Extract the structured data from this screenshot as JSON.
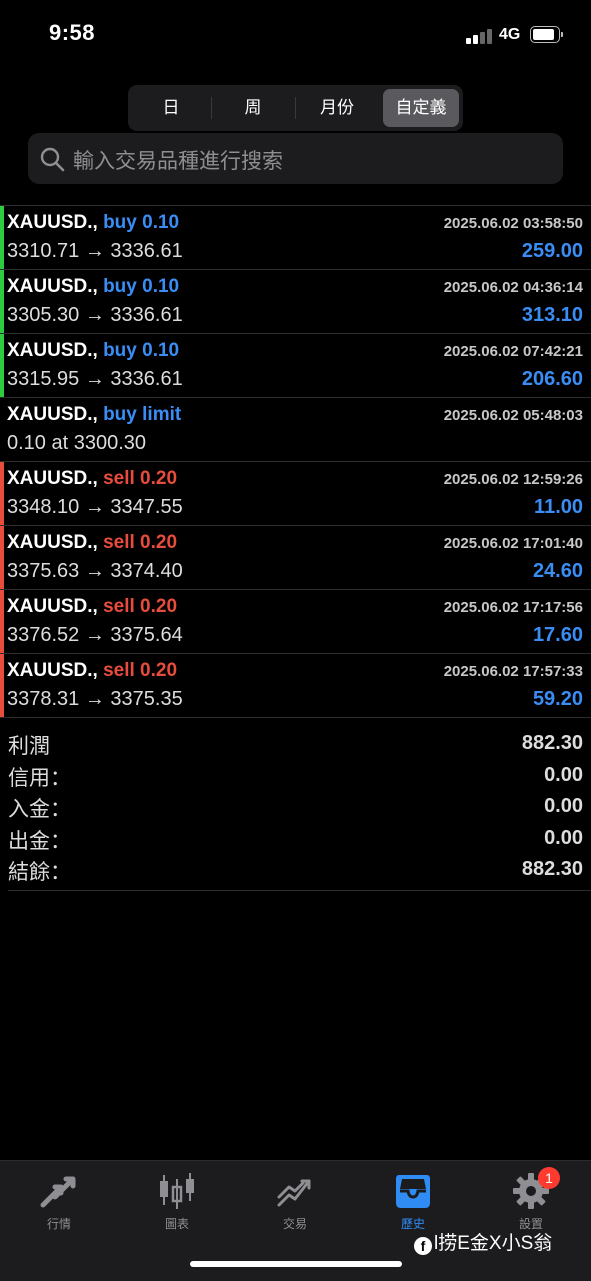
{
  "status": {
    "time": "9:58",
    "network": "4G"
  },
  "period_tabs": [
    {
      "label": "日"
    },
    {
      "label": "周"
    },
    {
      "label": "月份"
    },
    {
      "label": "自定義",
      "active": true
    }
  ],
  "search": {
    "placeholder": "輸入交易品種進行搜索"
  },
  "orders": [
    {
      "symbol": "XAUUSD.,",
      "type": "buy 0.10",
      "side": "buy",
      "prices": "3310.71 → 3336.61",
      "datetime": "2025.06.02 03:58:50",
      "profit": "259.00"
    },
    {
      "symbol": "XAUUSD.,",
      "type": "buy 0.10",
      "side": "buy",
      "prices": "3305.30 → 3336.61",
      "datetime": "2025.06.02 04:36:14",
      "profit": "313.10"
    },
    {
      "symbol": "XAUUSD.,",
      "type": "buy 0.10",
      "side": "buy",
      "prices": "3315.95 → 3336.61",
      "datetime": "2025.06.02 07:42:21",
      "profit": "206.60"
    },
    {
      "symbol": "XAUUSD.,",
      "type": "buy limit",
      "side": "buy",
      "prices": "0.10 at 3300.30",
      "datetime": "2025.06.02 05:48:03",
      "profit": ""
    },
    {
      "symbol": "XAUUSD.,",
      "type": "sell 0.20",
      "side": "sell",
      "prices": "3348.10 → 3347.55",
      "datetime": "2025.06.02 12:59:26",
      "profit": "11.00"
    },
    {
      "symbol": "XAUUSD.,",
      "type": "sell 0.20",
      "side": "sell",
      "prices": "3375.63 → 3374.40",
      "datetime": "2025.06.02 17:01:40",
      "profit": "24.60"
    },
    {
      "symbol": "XAUUSD.,",
      "type": "sell 0.20",
      "side": "sell",
      "prices": "3376.52 → 3375.64",
      "datetime": "2025.06.02 17:17:56",
      "profit": "17.60"
    },
    {
      "symbol": "XAUUSD.,",
      "type": "sell 0.20",
      "side": "sell",
      "prices": "3378.31 → 3375.35",
      "datetime": "2025.06.02 17:57:33",
      "profit": "59.20"
    }
  ],
  "summary": [
    {
      "label": "利潤",
      "value": "882.30"
    },
    {
      "label": "信用：",
      "value": "0.00"
    },
    {
      "label": "入金：",
      "value": "0.00"
    },
    {
      "label": "出金：",
      "value": "0.00"
    },
    {
      "label": "結餘：",
      "value": "882.30"
    }
  ],
  "tabbar": [
    {
      "label": "行情",
      "icon": "quotes-arrows-icon"
    },
    {
      "label": "圖表",
      "icon": "candlestick-chart-icon"
    },
    {
      "label": "交易",
      "icon": "trade-trend-icon"
    },
    {
      "label": "歷史",
      "icon": "history-inbox-icon",
      "active": true
    },
    {
      "label": "設置",
      "icon": "settings-gear-icon",
      "badge": "1"
    }
  ],
  "colors": {
    "buy": "#2ecc40",
    "sell": "#e74c3c",
    "accent": "#2f8cf5",
    "profit": "#3a8df5"
  },
  "watermark": "l捞E金X小S翁"
}
